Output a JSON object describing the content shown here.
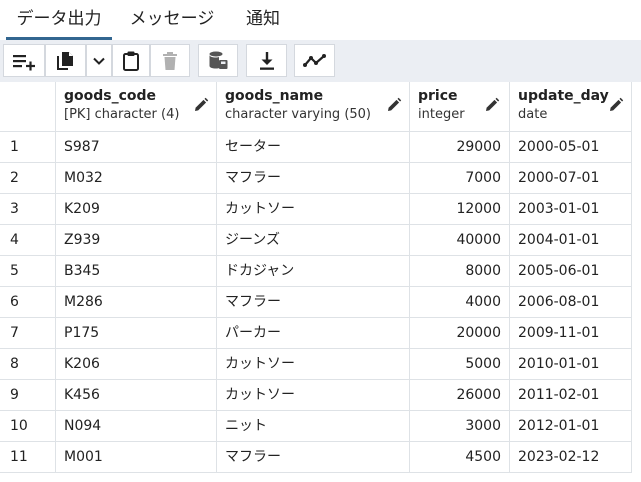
{
  "tabs": [
    {
      "label": "データ出力",
      "active": true
    },
    {
      "label": "メッセージ",
      "active": false
    },
    {
      "label": "通知",
      "active": false
    }
  ],
  "toolbar": {
    "buttons": [
      {
        "icon": "add-row-icon"
      },
      {
        "icon": "copy-icon"
      },
      {
        "icon": "chevron-down-icon"
      },
      {
        "icon": "paste-icon"
      },
      {
        "icon": "trash-icon"
      },
      {
        "icon": "database-save-icon"
      },
      {
        "icon": "download-icon"
      },
      {
        "icon": "graph-icon"
      }
    ]
  },
  "colors": {
    "accent": "#326690",
    "toolbar_bg": "#ebeef3",
    "grid_line": "#dee2e6"
  },
  "grid": {
    "columns": [
      {
        "name": "goods_code",
        "type": "[PK] character (4)"
      },
      {
        "name": "goods_name",
        "type": "character varying (50)"
      },
      {
        "name": "price",
        "type": "integer"
      },
      {
        "name": "update_day",
        "type": "date"
      }
    ],
    "rows": [
      {
        "n": "1",
        "cells": [
          "S987",
          "セーター",
          "29000",
          "2000-05-01"
        ]
      },
      {
        "n": "2",
        "cells": [
          "M032",
          "マフラー",
          "7000",
          "2000-07-01"
        ]
      },
      {
        "n": "3",
        "cells": [
          "K209",
          "カットソー",
          "12000",
          "2003-01-01"
        ]
      },
      {
        "n": "4",
        "cells": [
          "Z939",
          "ジーンズ",
          "40000",
          "2004-01-01"
        ]
      },
      {
        "n": "5",
        "cells": [
          "B345",
          "ドカジャン",
          "8000",
          "2005-06-01"
        ]
      },
      {
        "n": "6",
        "cells": [
          "M286",
          "マフラー",
          "4000",
          "2006-08-01"
        ]
      },
      {
        "n": "7",
        "cells": [
          "P175",
          "パーカー",
          "20000",
          "2009-11-01"
        ]
      },
      {
        "n": "8",
        "cells": [
          "K206",
          "カットソー",
          "5000",
          "2010-01-01"
        ]
      },
      {
        "n": "9",
        "cells": [
          "K456",
          "カットソー",
          "26000",
          "2011-02-01"
        ]
      },
      {
        "n": "10",
        "cells": [
          "N094",
          "ニット",
          "3000",
          "2012-01-01"
        ]
      },
      {
        "n": "11",
        "cells": [
          "M001",
          "マフラー",
          "4500",
          "2023-02-12"
        ]
      }
    ]
  }
}
